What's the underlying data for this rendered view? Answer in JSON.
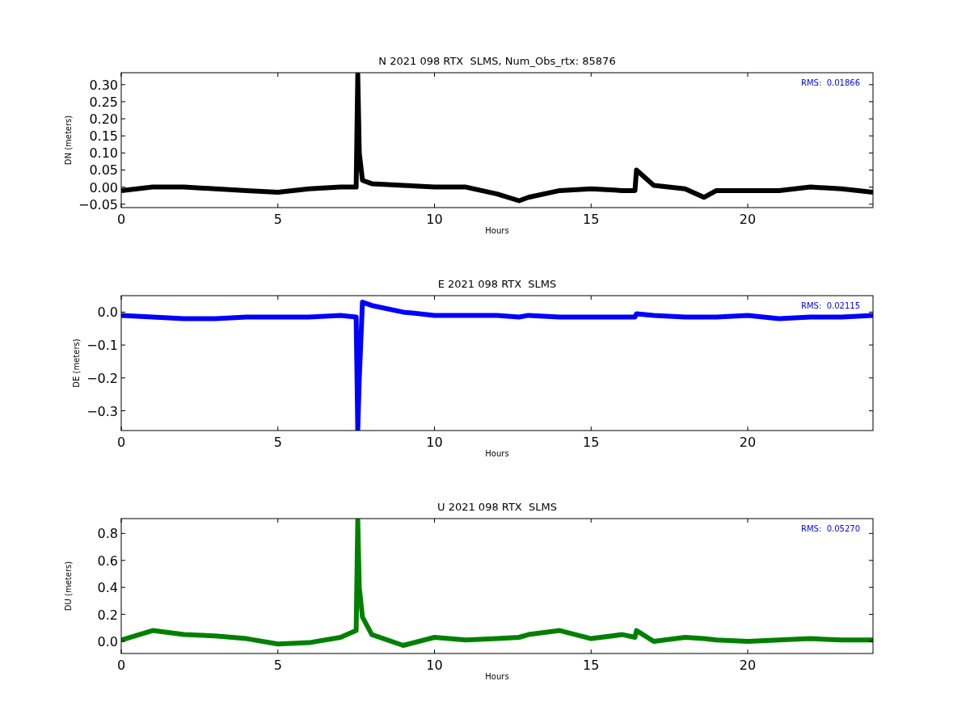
{
  "plots": [
    {
      "chart_data": {
        "type": "line",
        "title": "N 2021 098 RTX  SLMS, Num_Obs_rtx: 85876",
        "xlabel": "Hours",
        "ylabel": "DN (meters)",
        "x": [
          0,
          1,
          2,
          3,
          4,
          5,
          6,
          7,
          7.5,
          7.55,
          7.6,
          7.7,
          8,
          9,
          10,
          11,
          12,
          12.7,
          13,
          14,
          15,
          16,
          16.4,
          16.45,
          17,
          18,
          18.6,
          19,
          20,
          21,
          22,
          23,
          24
        ],
        "series": [
          {
            "color": "#000000",
            "values": [
              -0.01,
              0,
              0,
              -0.005,
              -0.01,
              -0.015,
              -0.005,
              0,
              0,
              0.33,
              0.1,
              0.02,
              0.01,
              0.005,
              0,
              0,
              -0.02,
              -0.04,
              -0.03,
              -0.01,
              -0.005,
              -0.01,
              -0.01,
              0.05,
              0.005,
              -0.005,
              -0.03,
              -0.01,
              -0.01,
              -0.01,
              0,
              -0.005,
              -0.015
            ]
          }
        ],
        "xlim": [
          0,
          24
        ],
        "ylim": [
          -0.06,
          0.335
        ],
        "xticks": [
          0,
          5,
          10,
          15,
          20
        ],
        "yticks": [
          {
            "value": -0.05,
            "label": "−0.05"
          },
          {
            "value": 0,
            "label": "0.00"
          },
          {
            "value": 0.05,
            "label": "0.05"
          },
          {
            "value": 0.1,
            "label": "0.10"
          },
          {
            "value": 0.15,
            "label": "0.15"
          },
          {
            "value": 0.2,
            "label": "0.20"
          },
          {
            "value": 0.25,
            "label": "0.25"
          },
          {
            "value": 0.3,
            "label": "0.30"
          }
        ],
        "annotations": [
          "RMS:  0.01866"
        ]
      }
    },
    {
      "chart_data": {
        "type": "line",
        "title": "E 2021 098 RTX  SLMS",
        "xlabel": "Hours",
        "ylabel": "DE (meters)",
        "x": [
          0,
          1,
          2,
          3,
          4,
          5,
          6,
          7,
          7.5,
          7.55,
          7.6,
          7.7,
          8,
          9,
          10,
          11,
          12,
          12.7,
          13,
          14,
          15,
          16,
          16.4,
          16.45,
          17,
          18,
          18.6,
          19,
          20,
          21,
          22,
          23,
          24
        ],
        "series": [
          {
            "color": "#0000ff",
            "values": [
              -0.01,
              -0.015,
              -0.02,
              -0.02,
              -0.015,
              -0.015,
              -0.015,
              -0.01,
              -0.015,
              -0.36,
              -0.2,
              0.03,
              0.02,
              0,
              -0.01,
              -0.01,
              -0.01,
              -0.015,
              -0.01,
              -0.015,
              -0.015,
              -0.015,
              -0.015,
              -0.005,
              -0.01,
              -0.015,
              -0.015,
              -0.015,
              -0.01,
              -0.02,
              -0.015,
              -0.015,
              -0.01
            ]
          }
        ],
        "xlim": [
          0,
          24
        ],
        "ylim": [
          -0.36,
          0.05
        ],
        "xticks": [
          0,
          5,
          10,
          15,
          20
        ],
        "yticks": [
          {
            "value": -0.3,
            "label": "−0.3"
          },
          {
            "value": -0.2,
            "label": "−0.2"
          },
          {
            "value": -0.1,
            "label": "−0.1"
          },
          {
            "value": 0,
            "label": "0.0"
          }
        ],
        "annotations": [
          "RMS:  0.02115"
        ]
      }
    },
    {
      "chart_data": {
        "type": "line",
        "title": "U 2021 098 RTX  SLMS",
        "xlabel": "Hours",
        "ylabel": "DU (meters)",
        "x": [
          0,
          1,
          2,
          3,
          4,
          5,
          6,
          7,
          7.5,
          7.55,
          7.6,
          7.7,
          8,
          9,
          10,
          11,
          12,
          12.7,
          13,
          14,
          15,
          16,
          16.4,
          16.45,
          17,
          18,
          18.6,
          19,
          20,
          21,
          22,
          23,
          24
        ],
        "series": [
          {
            "color": "#008000",
            "values": [
              0.01,
              0.08,
              0.05,
              0.04,
              0.02,
              -0.02,
              -0.01,
              0.03,
              0.08,
              0.9,
              0.4,
              0.18,
              0.05,
              -0.03,
              0.03,
              0.01,
              0.02,
              0.03,
              0.05,
              0.08,
              0.02,
              0.05,
              0.03,
              0.08,
              0,
              0.03,
              0.02,
              0.01,
              0,
              0.01,
              0.02,
              0.01,
              0.01
            ]
          }
        ],
        "xlim": [
          0,
          24
        ],
        "ylim": [
          -0.09,
          0.91
        ],
        "xticks": [
          0,
          5,
          10,
          15,
          20
        ],
        "yticks": [
          {
            "value": 0,
            "label": "0.0"
          },
          {
            "value": 0.2,
            "label": "0.2"
          },
          {
            "value": 0.4,
            "label": "0.4"
          },
          {
            "value": 0.6,
            "label": "0.6"
          },
          {
            "value": 0.8,
            "label": "0.8"
          }
        ],
        "annotations": [
          "RMS:  0.05270"
        ]
      }
    }
  ]
}
